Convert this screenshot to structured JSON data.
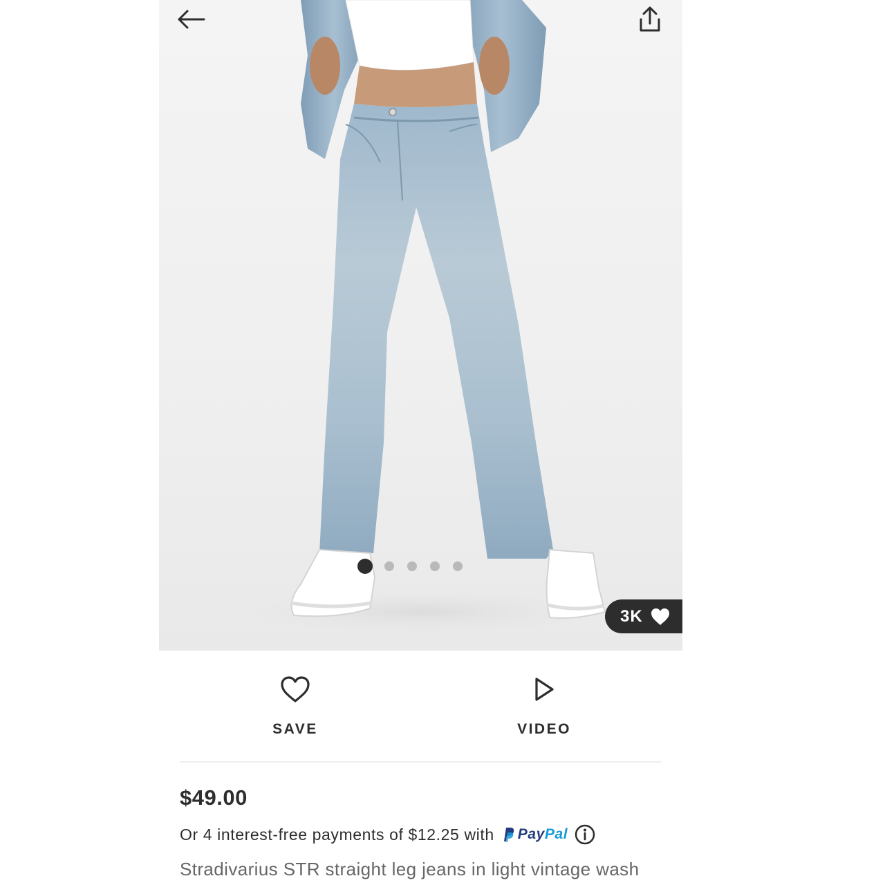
{
  "colors": {
    "text_primary": "#2d2d2d",
    "text_secondary": "#666666",
    "badge_bg": "#2d2d2d",
    "dot_active": "#2d2d2d",
    "dot_inactive": "#b9b9b9",
    "paypal_dark": "#253b80",
    "paypal_light": "#179bd7"
  },
  "header": {
    "back_icon": "arrow-left-icon",
    "share_icon": "share-icon"
  },
  "gallery": {
    "image_alt": "product photo",
    "total_images": 5,
    "active_index": 0,
    "likes_count": "3K",
    "likes_icon": "heart-filled-icon"
  },
  "actions": {
    "save": {
      "label": "SAVE",
      "icon": "heart-outline-icon"
    },
    "video": {
      "label": "VIDEO",
      "icon": "play-icon"
    }
  },
  "product": {
    "price": "$49.00",
    "installments_text": "Or 4 interest-free payments of $12.25 with",
    "paypal_label_1": "Pay",
    "paypal_label_2": "Pal",
    "info_icon": "info-icon",
    "name": "Stradivarius STR straight leg jeans in light vintage wash"
  }
}
